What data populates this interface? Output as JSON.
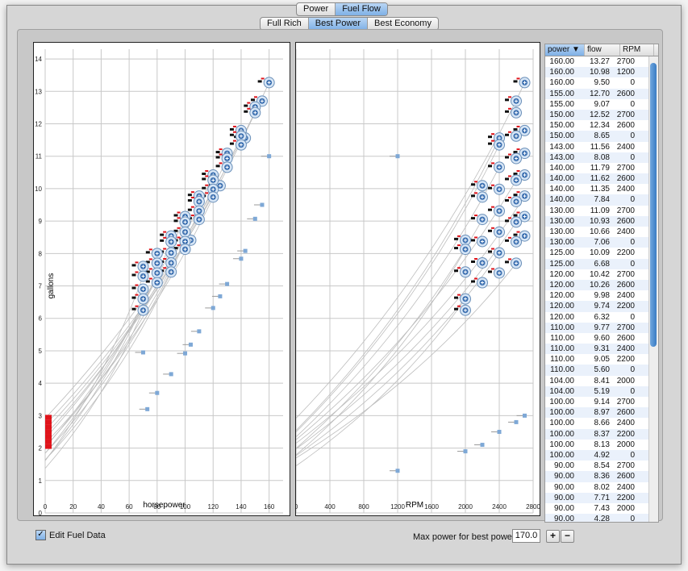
{
  "mode_selector": {
    "options": [
      "Power",
      "Fuel Flow"
    ],
    "selected": "Fuel Flow"
  },
  "power_setting_selector": {
    "options": [
      "Full Rich",
      "Best Power",
      "Best Economy"
    ],
    "selected": "Best Power"
  },
  "chart_data": [
    {
      "type": "scatter",
      "xlabel": "horsepower",
      "ylabel": "gallons",
      "xlim": [
        0,
        170
      ],
      "ylim": [
        0,
        14.3
      ],
      "xticks": [
        "0",
        "20",
        "40",
        "60",
        "80",
        "100",
        "120",
        "140",
        "160"
      ],
      "yticks": [
        "0",
        "1",
        "2",
        "3",
        "4",
        "5",
        "6",
        "7",
        "8",
        "9",
        "10",
        "11",
        "12",
        "13",
        "14"
      ],
      "grid": true,
      "series": [
        {
          "values": [
            [
              160,
              13.27
            ],
            [
              155,
              12.7
            ],
            [
              150,
              12.52
            ],
            [
              150,
              12.34
            ],
            [
              143,
              11.56
            ],
            [
              140,
              11.79
            ],
            [
              140,
              11.62
            ],
            [
              140,
              11.35
            ],
            [
              130,
              11.09
            ],
            [
              130,
              10.93
            ],
            [
              130,
              10.66
            ],
            [
              125,
              10.09
            ],
            [
              120,
              10.42
            ],
            [
              120,
              10.26
            ],
            [
              120,
              9.98
            ],
            [
              120,
              9.74
            ],
            [
              110,
              9.77
            ],
            [
              110,
              9.6
            ],
            [
              110,
              9.31
            ],
            [
              110,
              9.05
            ],
            [
              104,
              8.41
            ],
            [
              100,
              9.14
            ],
            [
              100,
              8.97
            ],
            [
              100,
              8.66
            ],
            [
              100,
              8.37
            ],
            [
              100,
              8.13
            ],
            [
              90,
              8.54
            ],
            [
              90,
              8.36
            ],
            [
              90,
              8.02
            ],
            [
              90,
              7.71
            ],
            [
              90,
              7.43
            ],
            [
              80,
              8.0
            ],
            [
              80,
              7.7
            ],
            [
              80,
              7.4
            ],
            [
              80,
              7.1
            ],
            [
              70,
              7.6
            ],
            [
              70,
              7.3
            ],
            [
              70,
              6.9
            ],
            [
              70,
              6.6
            ],
            [
              70,
              6.25
            ]
          ]
        },
        {
          "values": [
            [
              160,
              11.0
            ],
            [
              155,
              9.5
            ],
            [
              150,
              9.07
            ],
            [
              143,
              8.08
            ],
            [
              140,
              7.84
            ],
            [
              130,
              7.06
            ],
            [
              125,
              6.68
            ],
            [
              120,
              6.32
            ],
            [
              110,
              5.6
            ],
            [
              104,
              5.19
            ],
            [
              100,
              4.92
            ],
            [
              90,
              4.28
            ],
            [
              80,
              3.7
            ],
            [
              73,
              3.2
            ],
            [
              70,
              4.95
            ]
          ]
        }
      ]
    },
    {
      "type": "scatter",
      "xlabel": "RPM",
      "ylabel": "",
      "xlim": [
        0,
        2800
      ],
      "ylim": [
        0,
        14.3
      ],
      "xticks": [
        "0",
        "400",
        "800",
        "1200",
        "1600",
        "2000",
        "2400",
        "2800"
      ],
      "grid": true,
      "series": [
        {
          "values": [
            [
              2700,
              13.27
            ],
            [
              2600,
              12.7
            ],
            [
              2600,
              12.34
            ],
            [
              2400,
              11.56
            ],
            [
              2700,
              11.79
            ],
            [
              2600,
              11.62
            ],
            [
              2400,
              11.35
            ],
            [
              2700,
              11.09
            ],
            [
              2600,
              10.93
            ],
            [
              2400,
              10.66
            ],
            [
              2200,
              10.09
            ],
            [
              2700,
              10.42
            ],
            [
              2600,
              10.26
            ],
            [
              2400,
              9.98
            ],
            [
              2200,
              9.74
            ],
            [
              2700,
              9.77
            ],
            [
              2600,
              9.6
            ],
            [
              2400,
              9.31
            ],
            [
              2200,
              9.05
            ],
            [
              2000,
              8.41
            ],
            [
              2700,
              9.14
            ],
            [
              2600,
              8.97
            ],
            [
              2400,
              8.66
            ],
            [
              2200,
              8.37
            ],
            [
              2000,
              8.13
            ],
            [
              2700,
              8.54
            ],
            [
              2600,
              8.36
            ],
            [
              2400,
              8.02
            ],
            [
              2200,
              7.71
            ],
            [
              2000,
              7.43
            ],
            [
              2600,
              7.7
            ],
            [
              2400,
              7.4
            ],
            [
              2200,
              7.1
            ],
            [
              2000,
              6.6
            ],
            [
              2000,
              6.25
            ]
          ]
        },
        {
          "values": [
            [
              1200,
              11.0
            ],
            [
              1200,
              1.3
            ],
            [
              2000,
              1.9
            ],
            [
              2200,
              2.1
            ],
            [
              2400,
              2.5
            ],
            [
              2600,
              2.8
            ],
            [
              2700,
              3.0
            ]
          ]
        }
      ]
    }
  ],
  "table": {
    "columns": [
      "power",
      "flow",
      "RPM"
    ],
    "sort_indicator": "▼",
    "rows": [
      [
        "160.00",
        "13.27",
        "2700"
      ],
      [
        "160.00",
        "10.98",
        "1200"
      ],
      [
        "160.00",
        "9.50",
        "0"
      ],
      [
        "155.00",
        "12.70",
        "2600"
      ],
      [
        "155.00",
        "9.07",
        "0"
      ],
      [
        "150.00",
        "12.52",
        "2700"
      ],
      [
        "150.00",
        "12.34",
        "2600"
      ],
      [
        "150.00",
        "8.65",
        "0"
      ],
      [
        "143.00",
        "11.56",
        "2400"
      ],
      [
        "143.00",
        "8.08",
        "0"
      ],
      [
        "140.00",
        "11.79",
        "2700"
      ],
      [
        "140.00",
        "11.62",
        "2600"
      ],
      [
        "140.00",
        "11.35",
        "2400"
      ],
      [
        "140.00",
        "7.84",
        "0"
      ],
      [
        "130.00",
        "11.09",
        "2700"
      ],
      [
        "130.00",
        "10.93",
        "2600"
      ],
      [
        "130.00",
        "10.66",
        "2400"
      ],
      [
        "130.00",
        "7.06",
        "0"
      ],
      [
        "125.00",
        "10.09",
        "2200"
      ],
      [
        "125.00",
        "6.68",
        "0"
      ],
      [
        "120.00",
        "10.42",
        "2700"
      ],
      [
        "120.00",
        "10.26",
        "2600"
      ],
      [
        "120.00",
        "9.98",
        "2400"
      ],
      [
        "120.00",
        "9.74",
        "2200"
      ],
      [
        "120.00",
        "6.32",
        "0"
      ],
      [
        "110.00",
        "9.77",
        "2700"
      ],
      [
        "110.00",
        "9.60",
        "2600"
      ],
      [
        "110.00",
        "9.31",
        "2400"
      ],
      [
        "110.00",
        "9.05",
        "2200"
      ],
      [
        "110.00",
        "5.60",
        "0"
      ],
      [
        "104.00",
        "8.41",
        "2000"
      ],
      [
        "104.00",
        "5.19",
        "0"
      ],
      [
        "100.00",
        "9.14",
        "2700"
      ],
      [
        "100.00",
        "8.97",
        "2600"
      ],
      [
        "100.00",
        "8.66",
        "2400"
      ],
      [
        "100.00",
        "8.37",
        "2200"
      ],
      [
        "100.00",
        "8.13",
        "2000"
      ],
      [
        "100.00",
        "4.92",
        "0"
      ],
      [
        "90.00",
        "8.54",
        "2700"
      ],
      [
        "90.00",
        "8.36",
        "2600"
      ],
      [
        "90.00",
        "8.02",
        "2400"
      ],
      [
        "90.00",
        "7.71",
        "2200"
      ],
      [
        "90.00",
        "7.43",
        "2000"
      ],
      [
        "90.00",
        "4.28",
        "0"
      ]
    ]
  },
  "edit_fuel_data": {
    "label": "Edit Fuel Data",
    "checked": true,
    "check_glyph": "✓"
  },
  "max_power": {
    "label": "Max power for best power",
    "value": "170.0"
  },
  "stepper": {
    "plus": "+",
    "minus": "−"
  },
  "colors": {
    "grid": "#c8c8c8",
    "point": "#3b6fb0",
    "marker_fill": "#d7e6f6",
    "red": "#e0141b",
    "curve": "#bdbdbd",
    "accent": "#7fb0e6"
  }
}
